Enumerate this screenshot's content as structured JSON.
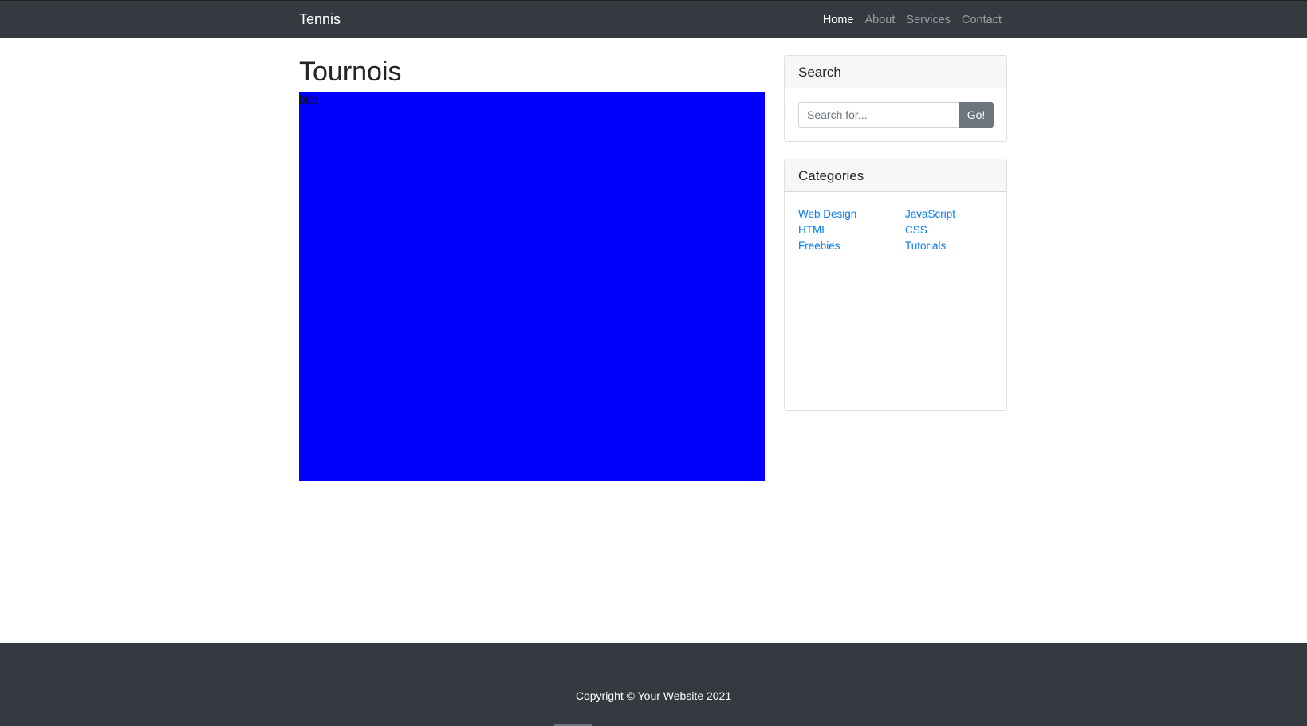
{
  "navbar": {
    "brand": "Tennis",
    "links": [
      {
        "label": "Home",
        "active": true
      },
      {
        "label": "About",
        "active": false
      },
      {
        "label": "Services",
        "active": false
      },
      {
        "label": "Contact",
        "active": false
      }
    ]
  },
  "main": {
    "title": "Tournois",
    "box_text": "bkc",
    "box_color": "#0000ff"
  },
  "search": {
    "header": "Search",
    "placeholder": "Search for...",
    "button_label": "Go!"
  },
  "categories": {
    "header": "Categories",
    "items": [
      "Web Design",
      "JavaScript",
      "HTML",
      "CSS",
      "Freebies",
      "Tutorials"
    ]
  },
  "footer": {
    "text": "Copyright © Your Website 2021"
  },
  "colors": {
    "navbar_bg": "#343a40",
    "link": "#007bff",
    "button_bg": "#6c757d"
  }
}
